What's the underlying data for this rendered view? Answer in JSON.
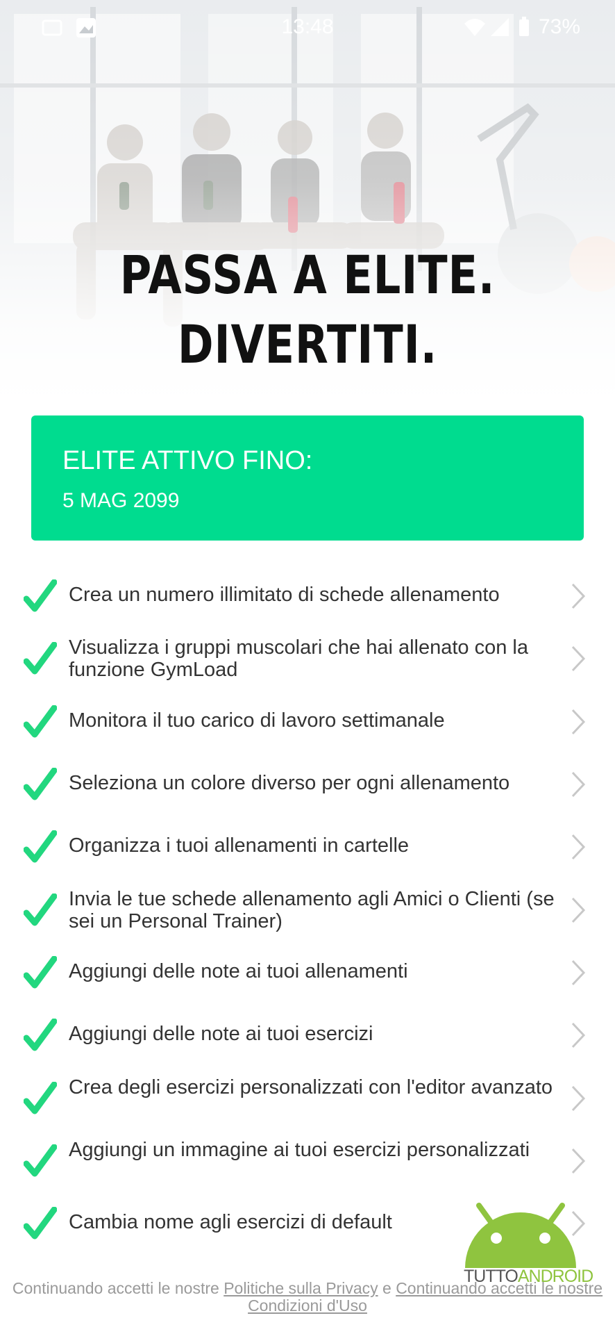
{
  "status_bar": {
    "time": "13:48",
    "battery": "73%"
  },
  "hero": {
    "title_line1": "PASSA A ELITE.",
    "title_line2": "DIVERTITI."
  },
  "elite": {
    "label": "ELITE ATTIVO FINO:",
    "date": "5 MAG 2099",
    "color": "#00dc8f"
  },
  "features": [
    {
      "text": "Crea un numero illimitato di schede allenamento"
    },
    {
      "text": "Visualizza i gruppi muscolari che hai allenato con la funzione GymLoad"
    },
    {
      "text": "Monitora il tuo carico di lavoro settimanale"
    },
    {
      "text": "Seleziona un colore diverso per ogni allenamento"
    },
    {
      "text": "Organizza i tuoi allenamenti in cartelle"
    },
    {
      "text": "Invia le tue schede allenamento agli Amici o Clienti (se sei un Personal Trainer)"
    },
    {
      "text": "Aggiungi delle note ai tuoi allenamenti"
    },
    {
      "text": "Aggiungi delle note ai tuoi esercizi"
    },
    {
      "text": "Crea degli esercizi personalizzati con l'editor avanzato"
    },
    {
      "text": "Aggiungi un immagine ai tuoi esercizi personalizzati"
    },
    {
      "text": "Cambia nome agli esercizi di default"
    }
  ],
  "footer": {
    "prefix": "Continuando accetti le nostre",
    "privacy_link": "Politiche sulla Privacy",
    "conjunction": "e",
    "terms_link": "Continuando accetti le nostre Condizioni d'Uso"
  },
  "watermark": {
    "part1": "TUTTO",
    "part2": "ANDROID"
  },
  "colors": {
    "check": "#22d77f",
    "chevron": "#c8c8c8",
    "accent": "#00dc8f"
  }
}
